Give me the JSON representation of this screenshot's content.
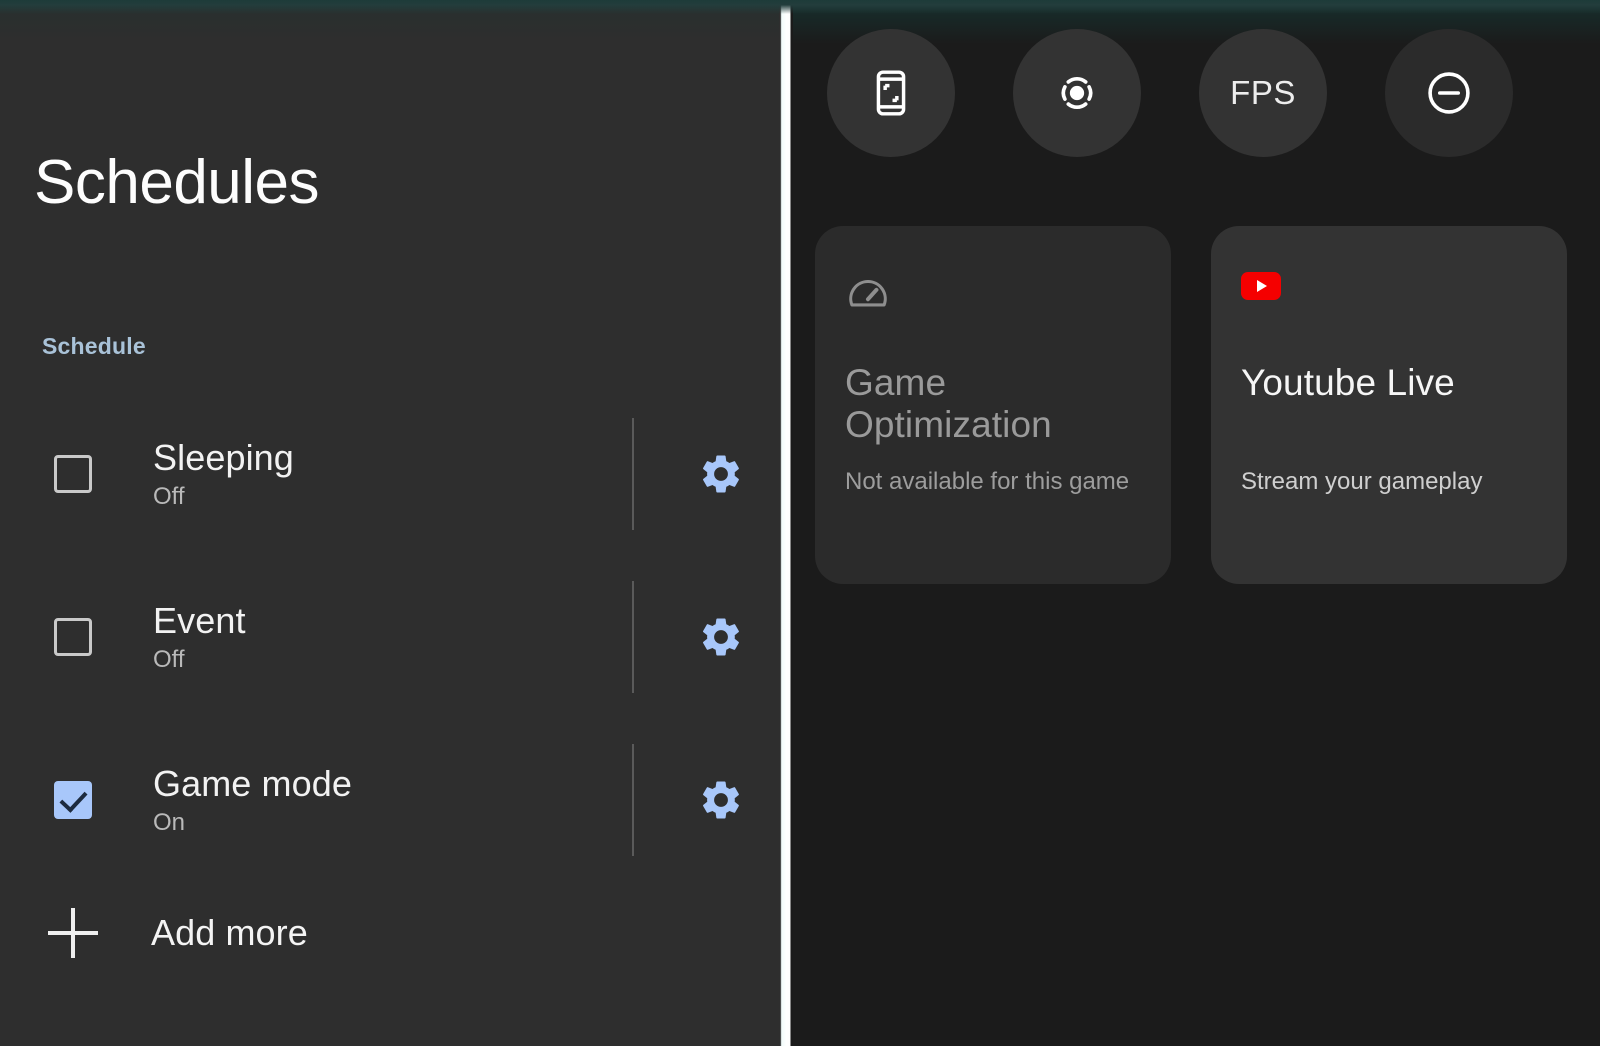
{
  "left": {
    "title": "Schedules",
    "section_label": "Schedule",
    "rows": [
      {
        "title": "Sleeping",
        "status": "Off",
        "checked": false,
        "settings_icon": "gear-icon"
      },
      {
        "title": "Event",
        "status": "Off",
        "checked": false,
        "settings_icon": "gear-icon"
      },
      {
        "title": "Game mode",
        "status": "On",
        "checked": true,
        "settings_icon": "gear-icon"
      }
    ],
    "add_more": {
      "label": "Add more",
      "icon": "plus-icon"
    }
  },
  "right": {
    "toolbar": [
      {
        "name": "screenshot-button",
        "icon": "phone-screenshot-icon",
        "label": ""
      },
      {
        "name": "screen-record-button",
        "icon": "record-dot-icon",
        "label": ""
      },
      {
        "name": "fps-button",
        "icon": "fps-text",
        "label": "FPS"
      },
      {
        "name": "do-not-disturb-button",
        "icon": "minus-circle-icon",
        "label": ""
      }
    ],
    "cards": [
      {
        "name": "game-optimization-card",
        "icon": "speedometer-icon",
        "title": "Game Optimization",
        "subtitle": "Not available for this game",
        "state": "disabled"
      },
      {
        "name": "youtube-live-card",
        "icon": "youtube-logo-icon",
        "title": "Youtube Live",
        "subtitle": "Stream your gameplay",
        "state": "active"
      }
    ]
  },
  "colors": {
    "accent_blue": "#a8c7fa",
    "section_label": "#a9c2d8",
    "youtube_red": "#f50000",
    "left_panel_bg": "#2e2e2e",
    "right_panel_bg": "#1b1b1b",
    "divider": "#ffffff"
  }
}
